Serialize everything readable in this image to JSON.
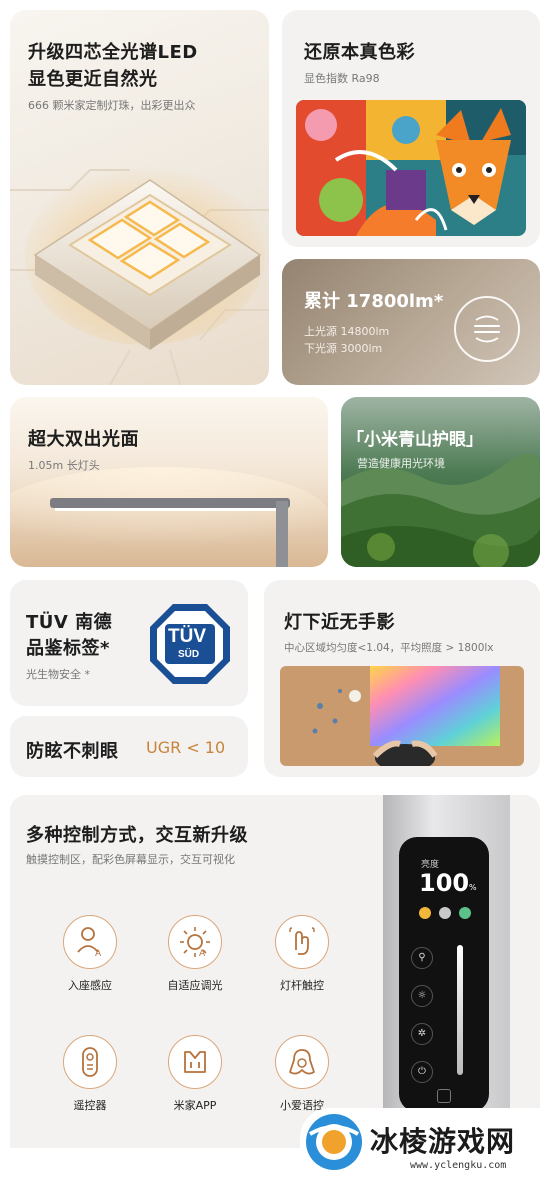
{
  "card_led": {
    "title_line1": "升级四芯全光谱LED",
    "title_line2": "显色更近自然光",
    "subtitle": "666 颗米家定制灯珠，出彩更出众"
  },
  "card_color": {
    "title": "还原本真色彩",
    "subtitle": "显色指数 Ra98"
  },
  "card_lumen": {
    "title": "累计 17800lm*",
    "line1": "上光源 14800lm",
    "line2": "下光源 3000lm"
  },
  "card_light_area": {
    "title": "超大双出光面",
    "subtitle": "1.05m 长灯头"
  },
  "card_eye": {
    "title": "「小米青山护眼」",
    "subtitle": "营造健康用光环境"
  },
  "card_tuv": {
    "title_line1": "TÜV 南德",
    "title_line2": "品鉴标签*",
    "subtitle": "光生物安全 *",
    "logo_top": "TÜV",
    "logo_bottom": "SÜD"
  },
  "card_shadow": {
    "title": "灯下近无手影",
    "subtitle": "中心区域均匀度<1.04，平均照度 > 1800lx"
  },
  "card_glare": {
    "title": "防眩不刺眼",
    "value": "UGR < 10"
  },
  "card_control": {
    "title": "多种控制方式，交互新升级",
    "subtitle": "触摸控制区，配彩色屏幕显示，交互可视化",
    "features": [
      {
        "icon": "seat-sensing-icon",
        "label": "入座感应"
      },
      {
        "icon": "adaptive-light-icon",
        "label": "自适应调光"
      },
      {
        "icon": "pole-touch-icon",
        "label": "灯杆触控"
      },
      {
        "icon": "remote-icon",
        "label": "遥控器"
      },
      {
        "icon": "mijia-app-icon",
        "label": "米家APP"
      },
      {
        "icon": "xiaoai-icon",
        "label": "小爱语控"
      }
    ],
    "screen_label": "亮度",
    "screen_value": "100",
    "screen_unit": "%"
  },
  "watermark": {
    "name": "冰棱游戏网",
    "url": "www.yclengku.com"
  },
  "colors": {
    "accent_orange": "#c8843a",
    "card_bg": "#f3f2f1"
  }
}
